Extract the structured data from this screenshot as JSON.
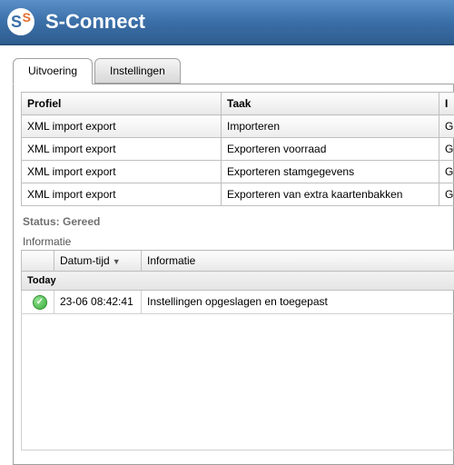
{
  "app": {
    "title": "S-Connect"
  },
  "tabs": {
    "execution": "Uitvoering",
    "settings": "Instellingen"
  },
  "grid": {
    "headers": {
      "profile": "Profiel",
      "task": "Taak",
      "col3": "I"
    },
    "rows": [
      {
        "profile": "XML import export",
        "task": "Importeren",
        "c3": "G"
      },
      {
        "profile": "XML import export",
        "task": "Exporteren voorraad",
        "c3": "G"
      },
      {
        "profile": "XML import export",
        "task": "Exporteren stamgegevens",
        "c3": "G"
      },
      {
        "profile": "XML import export",
        "task": "Exporteren van extra kaartenbakken",
        "c3": "G"
      }
    ]
  },
  "status": {
    "label": "Status: Gereed"
  },
  "info": {
    "section_label": "Informatie",
    "headers": {
      "datetime": "Datum-tijd",
      "info": "Informatie"
    },
    "group": "Today",
    "rows": [
      {
        "datetime": "23-06 08:42:41",
        "info": "Instellingen opgeslagen en toegepast"
      }
    ]
  }
}
